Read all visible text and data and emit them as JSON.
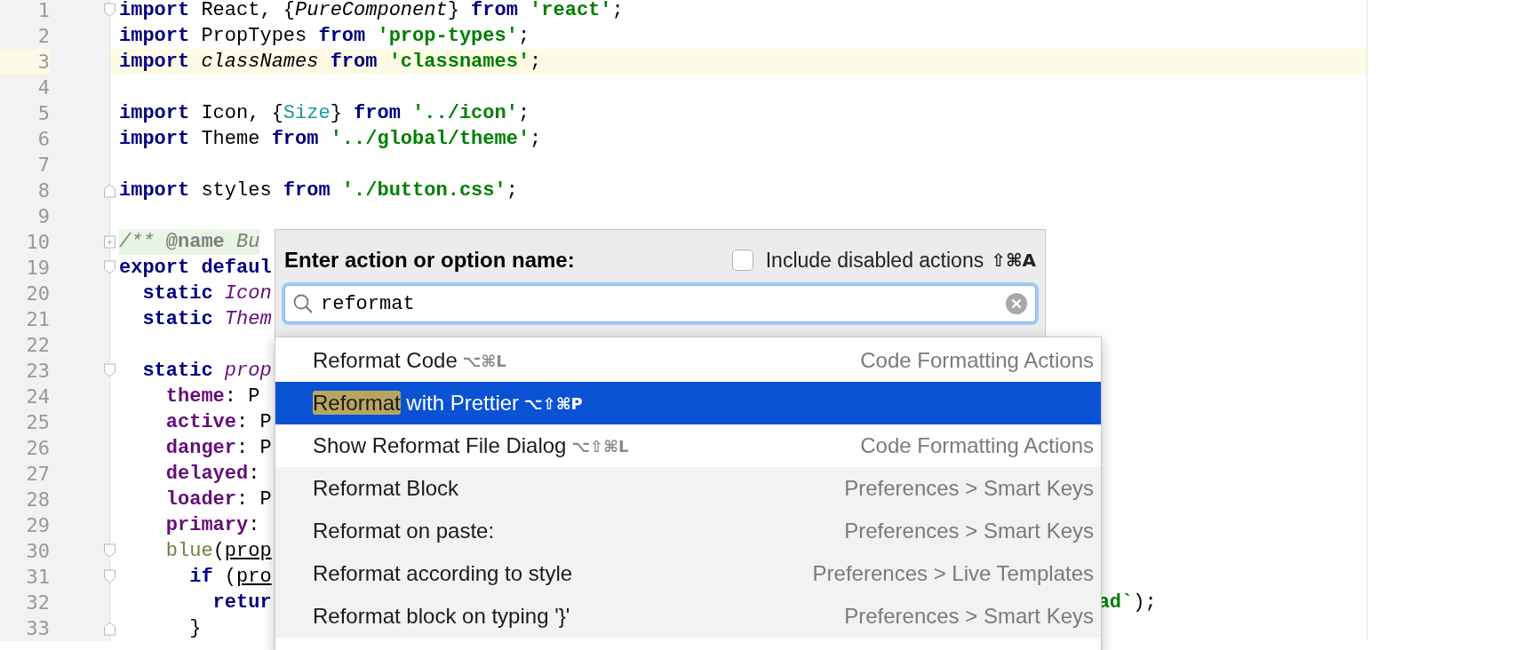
{
  "editor": {
    "lines": [
      {
        "number": "1",
        "fold": {
          "kind": "open"
        },
        "current": false,
        "tokens": [
          {
            "kind": "kw",
            "text": "import"
          },
          {
            "kind": "txt",
            "text": " React, {"
          },
          {
            "kind": "it",
            "text": "PureComponent"
          },
          {
            "kind": "txt",
            "text": "} "
          },
          {
            "kind": "kw",
            "text": "from"
          },
          {
            "kind": "str",
            "text": " 'react'"
          },
          {
            "kind": "txt",
            "text": ";"
          }
        ]
      },
      {
        "number": "2",
        "current": false,
        "tokens": [
          {
            "kind": "kw",
            "text": "import"
          },
          {
            "kind": "txt",
            "text": " PropTypes "
          },
          {
            "kind": "kw",
            "text": "from"
          },
          {
            "kind": "str",
            "text": " 'prop-types'"
          },
          {
            "kind": "txt",
            "text": ";"
          }
        ]
      },
      {
        "number": "3",
        "current": true,
        "tokens": [
          {
            "kind": "kw",
            "text": "import"
          },
          {
            "kind": "it",
            "text": " classNames "
          },
          {
            "kind": "kw",
            "text": "from"
          },
          {
            "kind": "str",
            "text": " 'classnames'"
          },
          {
            "kind": "txt",
            "text": ";"
          }
        ]
      },
      {
        "number": "4",
        "current": false
      },
      {
        "number": "5",
        "current": false,
        "tokens": [
          {
            "kind": "kw",
            "text": "import"
          },
          {
            "kind": "txt",
            "text": " Icon, {"
          },
          {
            "kind": "teal",
            "text": "Size"
          },
          {
            "kind": "txt",
            "text": "} "
          },
          {
            "kind": "kw",
            "text": "from"
          },
          {
            "kind": "str",
            "text": " '../icon'"
          },
          {
            "kind": "txt",
            "text": ";"
          }
        ]
      },
      {
        "number": "6",
        "current": false,
        "tokens": [
          {
            "kind": "kw",
            "text": "import"
          },
          {
            "kind": "txt",
            "text": " Theme "
          },
          {
            "kind": "kw",
            "text": "from"
          },
          {
            "kind": "str",
            "text": " '../global/theme'"
          },
          {
            "kind": "txt",
            "text": ";"
          }
        ]
      },
      {
        "number": "7",
        "current": false
      },
      {
        "number": "8",
        "fold": {
          "kind": "end"
        },
        "current": false,
        "tokens": [
          {
            "kind": "kw",
            "text": "import"
          },
          {
            "kind": "txt",
            "text": " styles "
          },
          {
            "kind": "kw",
            "text": "from"
          },
          {
            "kind": "str",
            "text": " './button.css'"
          },
          {
            "kind": "txt",
            "text": ";"
          }
        ]
      },
      {
        "number": "9",
        "current": false
      },
      {
        "number": "10",
        "fold": {
          "kind": "collapsed"
        },
        "current": false,
        "tokens": [
          {
            "kind": "cmt",
            "text": "/** "
          },
          {
            "kind": "meta",
            "text": "@name"
          },
          {
            "kind": "cmt",
            "text": " Bu"
          }
        ]
      },
      {
        "number": "19",
        "fold": {
          "kind": "open"
        },
        "current": false,
        "tokens": [
          {
            "kind": "kw",
            "text": "export defaul"
          }
        ]
      },
      {
        "number": "20",
        "current": false,
        "tokens": [
          {
            "kind": "kw",
            "text": "  static"
          },
          {
            "kind": "ivar",
            "text": " Icon"
          }
        ]
      },
      {
        "number": "21",
        "current": false,
        "tokens": [
          {
            "kind": "kw",
            "text": "  static"
          },
          {
            "kind": "ivar",
            "text": " Them"
          }
        ]
      },
      {
        "number": "22",
        "current": false
      },
      {
        "number": "23",
        "fold": {
          "kind": "open"
        },
        "current": false,
        "tokens": [
          {
            "kind": "kw",
            "text": "  static"
          },
          {
            "kind": "ivar",
            "text": " prop"
          }
        ]
      },
      {
        "number": "24",
        "current": false,
        "tokens": [
          {
            "kind": "pkey",
            "text": "    theme"
          },
          {
            "kind": "txt",
            "text": ": P"
          }
        ]
      },
      {
        "number": "25",
        "current": false,
        "tokens": [
          {
            "kind": "pkey",
            "text": "    active"
          },
          {
            "kind": "txt",
            "text": ": P"
          }
        ]
      },
      {
        "number": "26",
        "current": false,
        "tokens": [
          {
            "kind": "pkey",
            "text": "    danger"
          },
          {
            "kind": "txt",
            "text": ": P"
          }
        ]
      },
      {
        "number": "27",
        "current": false,
        "tokens": [
          {
            "kind": "pkey",
            "text": "    delayed"
          },
          {
            "kind": "txt",
            "text": ":"
          }
        ]
      },
      {
        "number": "28",
        "current": false,
        "tokens": [
          {
            "kind": "pkey",
            "text": "    loader"
          },
          {
            "kind": "txt",
            "text": ": P"
          }
        ]
      },
      {
        "number": "29",
        "current": false,
        "tokens": [
          {
            "kind": "pkey",
            "text": "    primary"
          },
          {
            "kind": "txt",
            "text": ":"
          }
        ]
      },
      {
        "number": "30",
        "fold": {
          "kind": "open"
        },
        "current": false,
        "tokens": [
          {
            "kind": "fn",
            "text": "    blue"
          },
          {
            "kind": "txt",
            "text": "("
          },
          {
            "kind": "ul",
            "text": "prop"
          }
        ]
      },
      {
        "number": "31",
        "fold": {
          "kind": "open"
        },
        "current": false,
        "tokens": [
          {
            "kind": "kw",
            "text": "      if"
          },
          {
            "kind": "txt",
            "text": " ("
          },
          {
            "kind": "ul",
            "text": "pro"
          }
        ]
      },
      {
        "number": "32",
        "current": false,
        "tokens": [
          {
            "kind": "kw",
            "text": "        retur"
          }
        ],
        "tail": [
          {
            "kind": "str",
            "text": "ad`"
          },
          {
            "kind": "txt",
            "text": ");"
          }
        ]
      },
      {
        "number": "33",
        "fold": {
          "kind": "end"
        },
        "current": false,
        "tokens": [
          {
            "kind": "txt",
            "text": "      }"
          }
        ]
      }
    ]
  },
  "popup": {
    "prompt": "Enter action or option name:",
    "include_disabled": {
      "label": "Include disabled actions",
      "shortcut": "⇧⌘A",
      "checked": false
    },
    "search": {
      "value": "reformat"
    },
    "results": [
      {
        "kind": "action",
        "match": "Reformat",
        "rest": " Code",
        "shortcut": "⌥⌘L",
        "group": "Code Formatting Actions",
        "selected": false
      },
      {
        "kind": "action",
        "match": "Reformat",
        "rest": " with Prettier",
        "shortcut": "⌥⇧⌘P",
        "selected": true
      },
      {
        "kind": "action",
        "match": "Show Reformat",
        "rest": " File Dialog",
        "shortcut": "⌥⇧⌘L",
        "group": "Code Formatting Actions",
        "selected": false
      },
      {
        "kind": "option",
        "match": "Reformat",
        "rest": " Block",
        "group": "Preferences > Smart Keys",
        "selected": false
      },
      {
        "kind": "option",
        "match": "Reformat",
        "rest": " on paste:",
        "group": "Preferences > Smart Keys",
        "selected": false
      },
      {
        "kind": "option",
        "match": "Reformat",
        "rest": " according to style",
        "group": "Preferences > Live Templates",
        "selected": false
      },
      {
        "kind": "option",
        "match": "Reformat",
        "rest": " block on typing '}'",
        "group": "Preferences > Smart Keys",
        "selected": false
      }
    ]
  }
}
